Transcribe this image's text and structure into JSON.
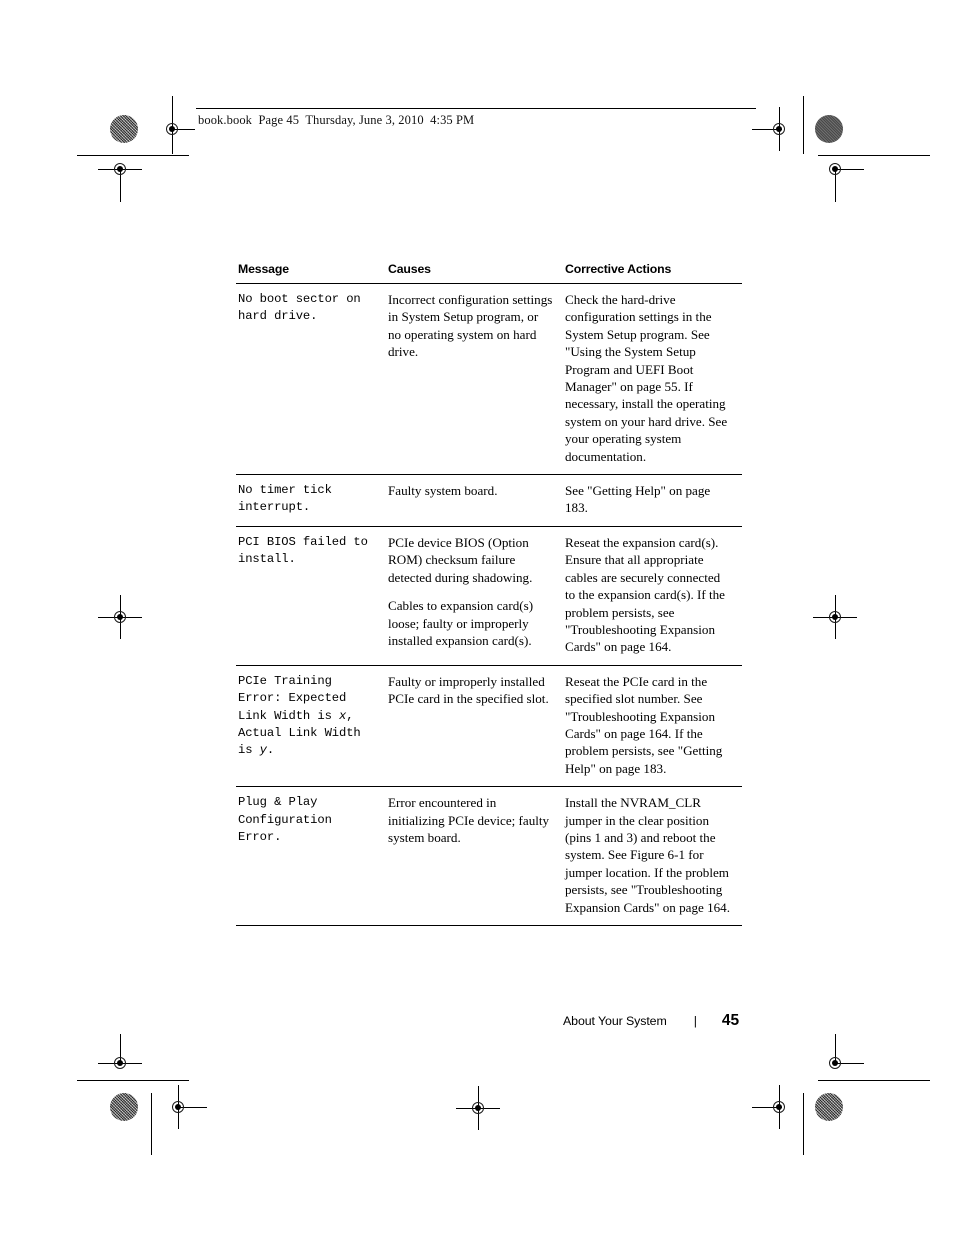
{
  "page_header": {
    "text": "book.book  Page 45  Thursday, June 3, 2010  4:35 PM"
  },
  "table": {
    "columns": [
      "Message",
      "Causes",
      "Corrective Actions"
    ],
    "rows": [
      {
        "message": "No boot sector on hard drive.",
        "causes": [
          "Incorrect configuration settings in System Setup program, or no operating system on hard drive."
        ],
        "actions": [
          "Check the hard-drive configuration settings in the System Setup program. See \"Using the System Setup Program and UEFI Boot Manager\" on page 55. If necessary, install the operating system on your hard drive. See your operating system documentation."
        ]
      },
      {
        "message": "No timer tick interrupt.",
        "causes": [
          "Faulty system board."
        ],
        "actions": [
          "See \"Getting Help\" on page 183."
        ]
      },
      {
        "message": "PCI BIOS failed to install.",
        "causes": [
          "PCIe device BIOS (Option ROM) checksum failure detected during shadowing.",
          "Cables to expansion card(s) loose; faulty or improperly installed expansion card(s)."
        ],
        "actions": [
          "Reseat the expansion card(s). Ensure that all appropriate cables are securely connected to the expansion card(s). If the problem persists, see \"Troubleshooting Expansion Cards\" on page 164."
        ]
      },
      {
        "message_parts": [
          {
            "text": "PCIe Training Error: Expected Link Width is ",
            "style": "normal"
          },
          {
            "text": "x",
            "style": "italic"
          },
          {
            "text": ", Actual Link Width is ",
            "style": "normal"
          },
          {
            "text": "y",
            "style": "italic"
          },
          {
            "text": ".",
            "style": "normal"
          }
        ],
        "message": "PCIe Training Error: Expected Link Width is x, Actual Link Width is y.",
        "causes": [
          "Faulty or improperly installed PCIe card in the specified slot."
        ],
        "actions": [
          "Reseat the PCIe card in the specified slot number. See \"Troubleshooting Expansion Cards\" on page 164. If the problem persists, see \"Getting Help\" on page 183."
        ]
      },
      {
        "message": "Plug & Play Configuration Error.",
        "causes": [
          "Error encountered in initializing PCIe device; faulty system board."
        ],
        "actions": [
          "Install the NVRAM_CLR jumper in the clear position (pins 1 and 3) and reboot the system. See Figure 6-1 for jumper location. If the problem persists, see \"Troubleshooting Expansion Cards\" on page 164."
        ]
      }
    ]
  },
  "page_footer": {
    "section": "About Your System",
    "separator": "|",
    "page_number": "45"
  }
}
